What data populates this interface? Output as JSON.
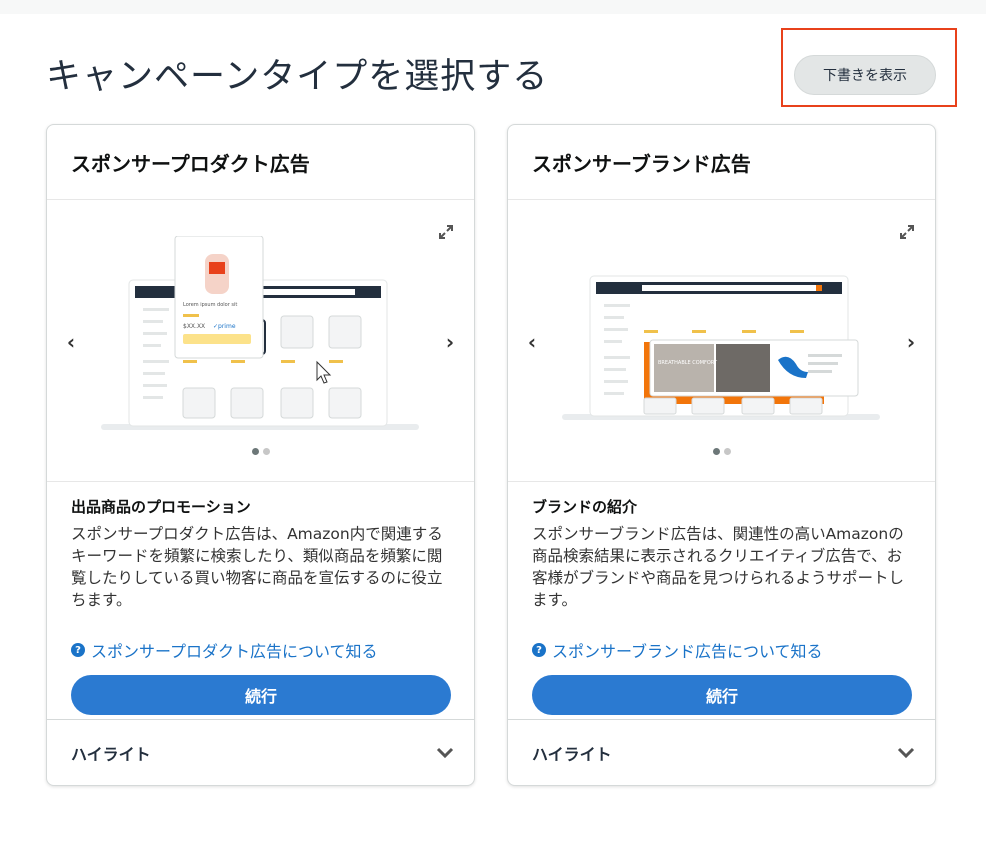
{
  "page": {
    "title": "キャンペーンタイプを選択する",
    "draft_button": "下書きを表示"
  },
  "cards": [
    {
      "title": "スポンサープロダクト広告",
      "subtitle": "出品商品のプロモーション",
      "description": "スポンサープロダクト広告は、Amazon内で関連するキーワードを頻繁に検索したり、類似商品を頻繁に閲覧したりしている買い物客に商品を宣伝するのに役立ちます。",
      "learn_more": "スポンサープロダクト広告について知る",
      "continue": "続行",
      "highlight": "ハイライト"
    },
    {
      "title": "スポンサーブランド広告",
      "subtitle": "ブランドの紹介",
      "description": "スポンサーブランド広告は、関連性の高いAmazonの商品検索結果に表示されるクリエイティブ広告で、お客様がブランドや商品を見つけられるようサポートします。",
      "learn_more": "スポンサーブランド広告について知る",
      "continue": "続行",
      "highlight": "ハイライト"
    }
  ],
  "illustration_text": {
    "sp_popup_title": "Lorem ipsum dolor sit amet sed diam",
    "sp_price": "$XX.XX",
    "sp_prime": "✓prime",
    "sb_banner": "BREATHABLE COMFORT"
  },
  "colors": {
    "accent": "#2b7ad1",
    "link": "#1a73c8",
    "highlight_border": "#e8411b",
    "brand_orange": "#f2750a"
  }
}
